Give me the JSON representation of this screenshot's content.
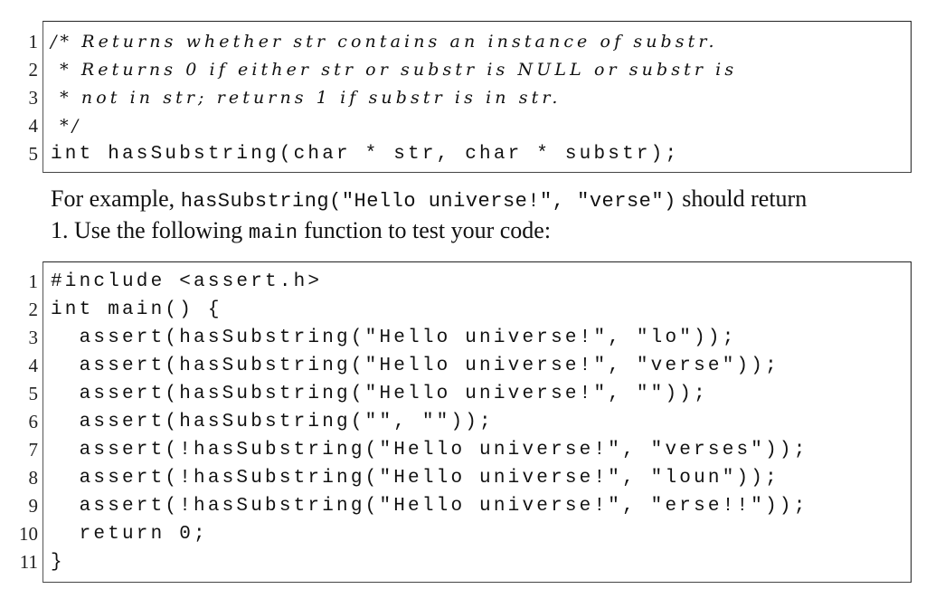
{
  "listing1": {
    "lines": [
      {
        "no": "1",
        "text": "/* Returns whether str contains an instance of substr.",
        "comment": true
      },
      {
        "no": "2",
        "text": " * Returns 0 if either str or substr is NULL or substr is",
        "comment": true
      },
      {
        "no": "3",
        "text": " * not in str; returns 1 if substr is in str.",
        "comment": true
      },
      {
        "no": "4",
        "text": " */",
        "comment": true
      },
      {
        "no": "5",
        "text": "int hasSubstring(char * str, char * substr);",
        "comment": false
      }
    ]
  },
  "paragraph": {
    "line1_prefix": "For example, ",
    "line1_code": "hasSubstring(\"Hello universe!\", \"verse\")",
    "line1_suffix": " should return",
    "line2_prefix": "1. Use the following ",
    "line2_code": "main",
    "line2_suffix": " function to test your code:"
  },
  "listing2": {
    "lines": [
      {
        "no": "1",
        "text": "#include <assert.h>"
      },
      {
        "no": "2",
        "text": "int main() {"
      },
      {
        "no": "3",
        "text": "  assert(hasSubstring(\"Hello universe!\", \"lo\"));"
      },
      {
        "no": "4",
        "text": "  assert(hasSubstring(\"Hello universe!\", \"verse\"));"
      },
      {
        "no": "5",
        "text": "  assert(hasSubstring(\"Hello universe!\", \"\"));"
      },
      {
        "no": "6",
        "text": "  assert(hasSubstring(\"\", \"\"));"
      },
      {
        "no": "7",
        "text": "  assert(!hasSubstring(\"Hello universe!\", \"verses\"));"
      },
      {
        "no": "8",
        "text": "  assert(!hasSubstring(\"Hello universe!\", \"loun\"));"
      },
      {
        "no": "9",
        "text": "  assert(!hasSubstring(\"Hello universe!\", \"erse!!\"));"
      },
      {
        "no": "10",
        "text": "  return 0;"
      },
      {
        "no": "11",
        "text": "}"
      }
    ]
  }
}
